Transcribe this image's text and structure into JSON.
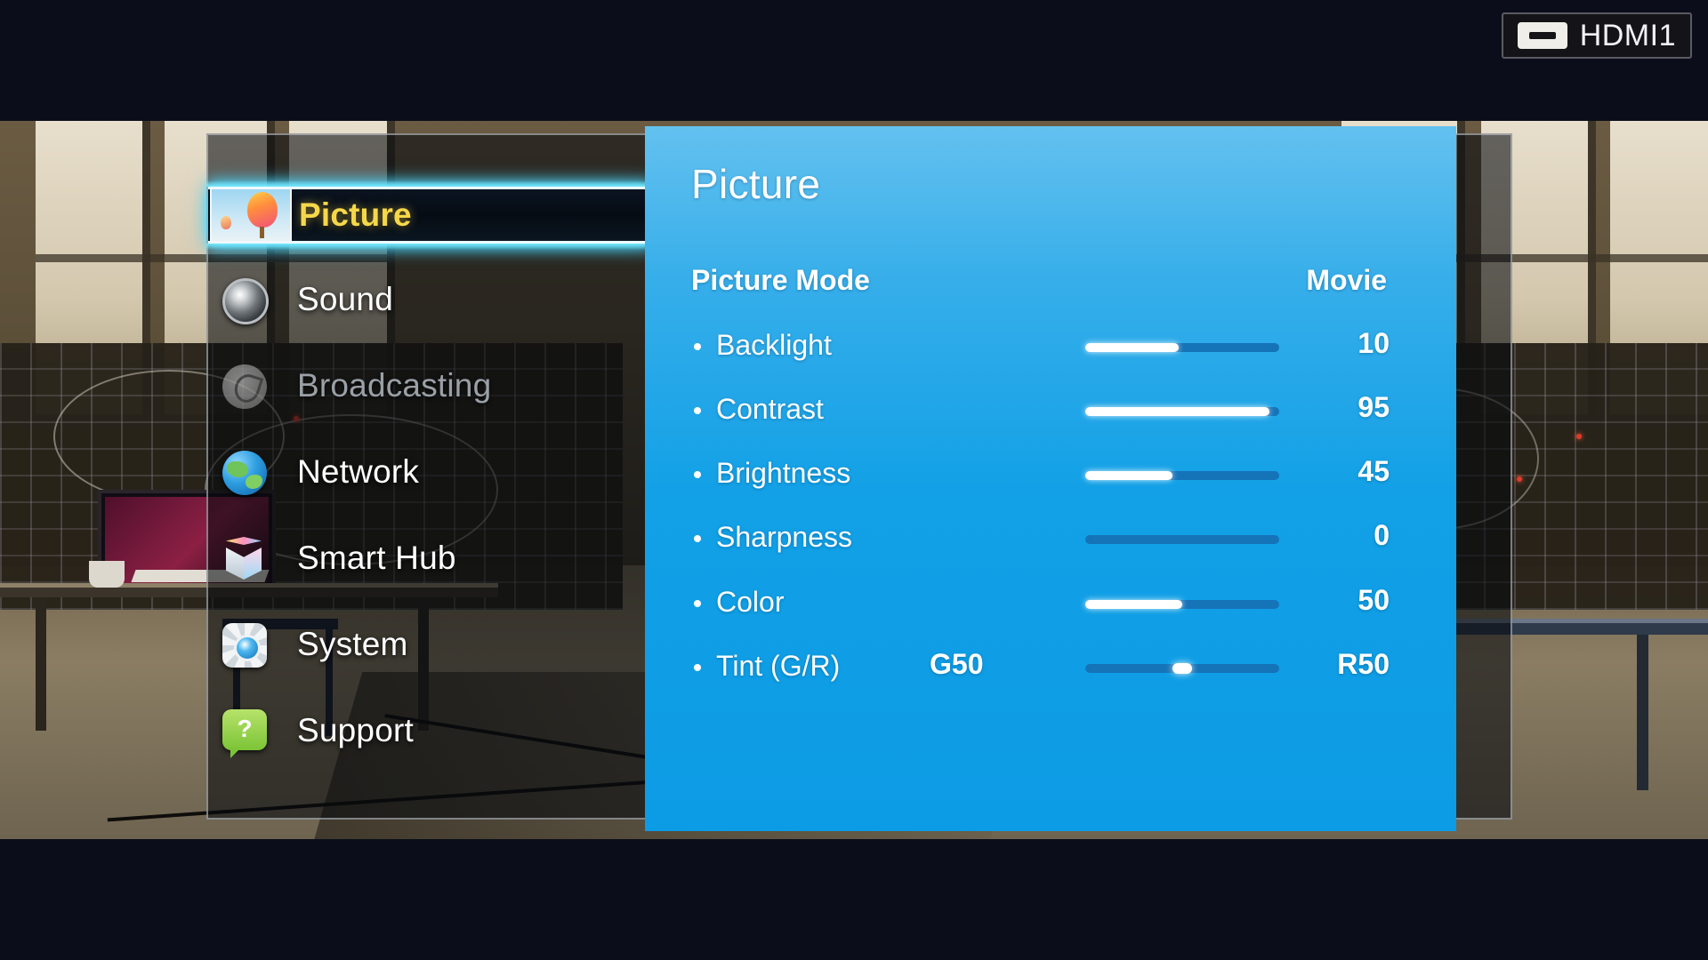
{
  "source_badge": {
    "label": "HDMI1",
    "port_icon": "hdmi-port-icon"
  },
  "sidebar": {
    "items": [
      {
        "label": "Picture",
        "icon": "balloon-photo-icon",
        "state": "selected"
      },
      {
        "label": "Sound",
        "icon": "speaker-icon",
        "state": "normal"
      },
      {
        "label": "Broadcasting",
        "icon": "satellite-dish-icon",
        "state": "disabled"
      },
      {
        "label": "Network",
        "icon": "globe-icon",
        "state": "normal"
      },
      {
        "label": "Smart Hub",
        "icon": "cube-icon",
        "state": "normal"
      },
      {
        "label": "System",
        "icon": "gear-icon",
        "state": "normal"
      },
      {
        "label": "Support",
        "icon": "question-bubble-icon",
        "state": "normal"
      }
    ]
  },
  "panel": {
    "title": "Picture",
    "picture_mode": {
      "label": "Picture Mode",
      "value": "Movie"
    },
    "settings": [
      {
        "label": "Backlight",
        "value": "10",
        "fill_percent": 48,
        "type": "fill"
      },
      {
        "label": "Contrast",
        "value": "95",
        "fill_percent": 95,
        "type": "fill"
      },
      {
        "label": "Brightness",
        "value": "45",
        "fill_percent": 45,
        "type": "fill"
      },
      {
        "label": "Sharpness",
        "value": "0",
        "fill_percent": 0,
        "type": "fill"
      },
      {
        "label": "Color",
        "value": "50",
        "fill_percent": 50,
        "type": "fill"
      },
      {
        "label": "Tint (G/R)",
        "value": "R50",
        "left_value": "G50",
        "thumb_percent": 50,
        "type": "thumb"
      }
    ]
  },
  "colors": {
    "panel_top": "#63c1ef",
    "panel_bottom": "#0c9ce5",
    "slider_track": "#1573b8",
    "slider_fill": "#ffffff",
    "selected_text": "#f5d84a",
    "highlight_glow": "#78ebff",
    "disabled_text": "#9aa0a6"
  }
}
